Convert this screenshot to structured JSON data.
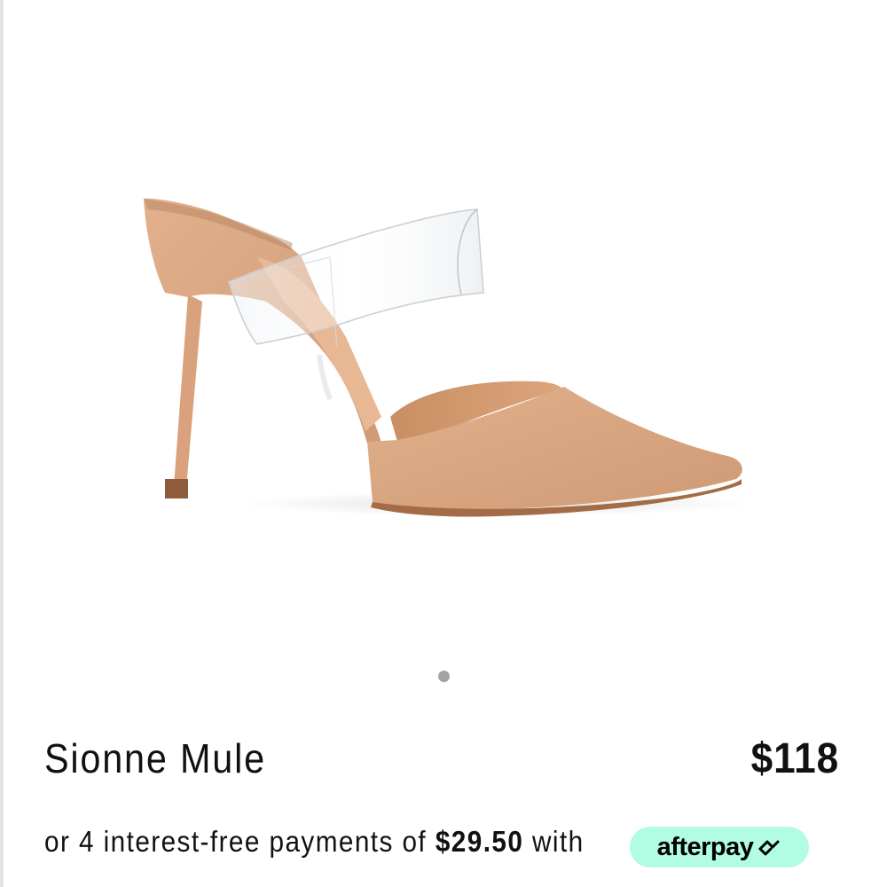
{
  "product": {
    "name": "Sionne Mule",
    "price": "$118",
    "image_icon": "shoe-photo"
  },
  "gallery": {
    "current_slide": 1,
    "total_slides": 1
  },
  "payment": {
    "prefix": "or 4 interest-free payments of",
    "amount": "$29.50",
    "suffix": "with",
    "provider_label": "afterpay",
    "provider_color": "#b2fce4",
    "provider_icon": "afterpay-arrows-icon"
  }
}
